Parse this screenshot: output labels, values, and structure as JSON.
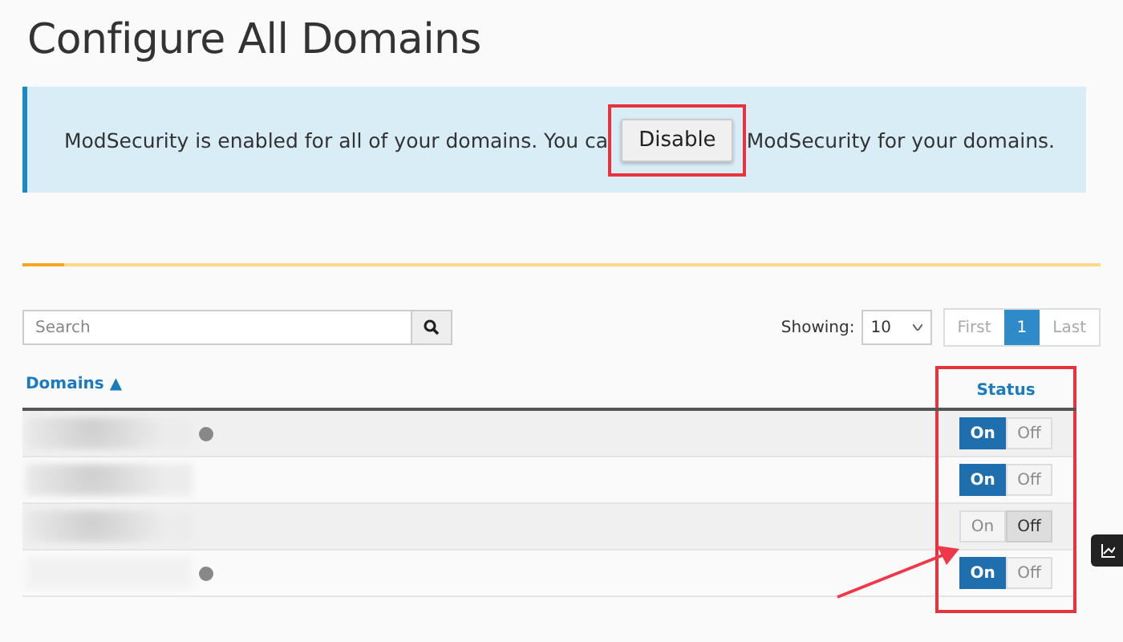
{
  "page_title": "Configure All Domains",
  "alert": {
    "text_before": "ModSecurity is enabled for all of your domains. You ca",
    "button": "Disable",
    "text_after": "ModSecurity for your domains."
  },
  "search": {
    "placeholder": "Search"
  },
  "paging": {
    "label": "Showing:",
    "page_size": "10",
    "pages": [
      {
        "label": "First",
        "selected": false
      },
      {
        "label": "1",
        "selected": true
      },
      {
        "label": "Last",
        "selected": false
      }
    ]
  },
  "table": {
    "columns": [
      {
        "label": "Domains ▲"
      },
      {
        "label": "Status"
      }
    ],
    "rows": [
      {
        "info_icon": true,
        "on": true,
        "on_label": "On",
        "off_label": "Off"
      },
      {
        "info_icon": false,
        "on": true,
        "on_label": "On",
        "off_label": "Off"
      },
      {
        "info_icon": false,
        "on": false,
        "on_label": "On",
        "off_label": "Off"
      },
      {
        "info_icon": true,
        "on": true,
        "on_label": "On",
        "off_label": "Off"
      }
    ]
  }
}
